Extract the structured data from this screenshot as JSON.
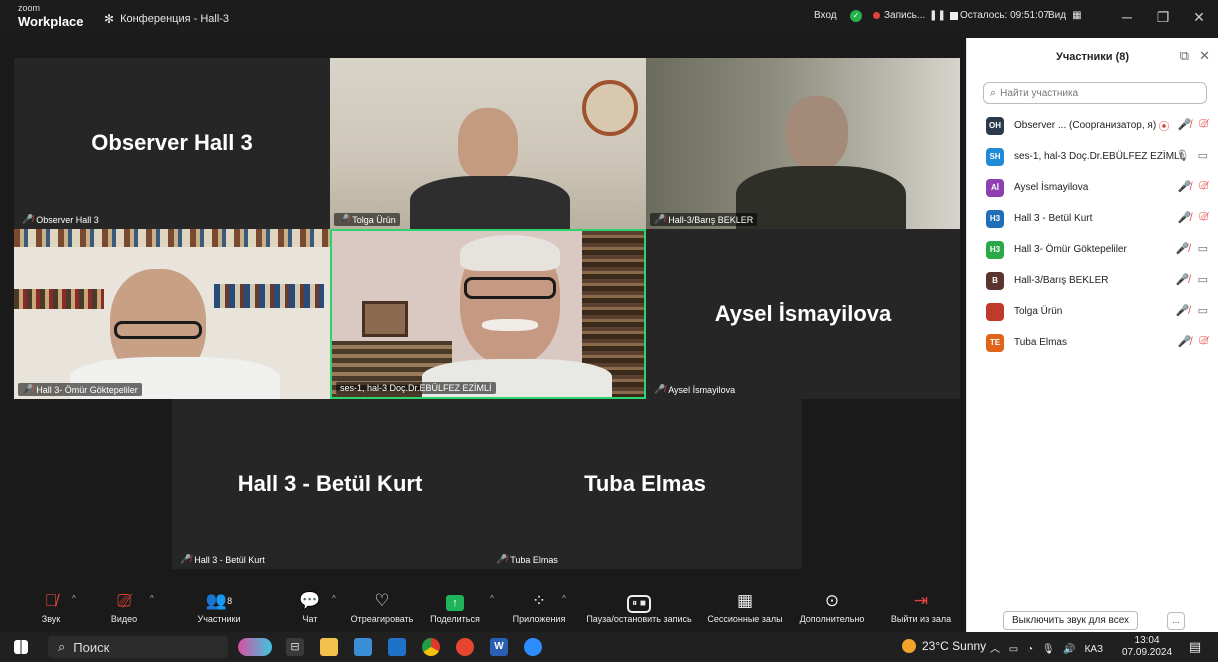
{
  "app": {
    "logo_top": "zoom",
    "logo_bottom": "Workplace",
    "meeting_title": "Конференция - Hall-3"
  },
  "topbar": {
    "login": "Вход",
    "recording": "Запись...",
    "remaining": "Осталось: 09:51:07",
    "view": "Вид"
  },
  "tiles": {
    "observer": {
      "big": "Observer Hall 3",
      "tag": "Observer Hall 3"
    },
    "tolga": {
      "tag": "Tolga Ürün"
    },
    "baris": {
      "tag": "Hall-3/Barış BEKLER"
    },
    "omur": {
      "tag": "Hall 3- Ömür Göktepeliler"
    },
    "ebulfez": {
      "tag": "ses-1, hal-3 Doç.Dr.EBÜLFEZ EZİMLİ"
    },
    "aysel": {
      "big": "Aysel İsmayilova",
      "tag": "Aysel İsmayilova"
    },
    "betul": {
      "big": "Hall 3 - Betül Kurt",
      "tag": "Hall 3 - Betül Kurt"
    },
    "tuba": {
      "big": "Tuba Elmas",
      "tag": "Tuba Elmas"
    }
  },
  "toolbar": {
    "audio": "Звук",
    "video": "Видео",
    "participants": "Участники",
    "participants_count": "8",
    "chat": "Чат",
    "react": "Отреагировать",
    "share": "Поделиться",
    "apps": "Приложения",
    "pause_rec": "Пауза/остановить запись",
    "breakout": "Сессионные залы",
    "more": "Дополнительно",
    "leave": "Выйти из зала"
  },
  "panel": {
    "title": "Участники (8)",
    "search_placeholder": "Найти участника",
    "participants": [
      {
        "initials": "OH",
        "name": "Observer ... (Соорганизатор, я)",
        "color": "#2a3a4a"
      },
      {
        "initials": "SH",
        "name": "ses-1, hal-3 Doç.Dr.EBÜLFEZ EZİMLİ",
        "color": "#1f8ad6"
      },
      {
        "initials": "Aİ",
        "name": "Aysel İsmayilova",
        "color": "#8e3fb0"
      },
      {
        "initials": "H3",
        "name": "Hall 3 - Betül Kurt",
        "color": "#1f6fb8"
      },
      {
        "initials": "H3",
        "name": "Hall 3- Ömür Göktepeliler",
        "color": "#2aa84a"
      },
      {
        "initials": "B",
        "name": "Hall-3/Barış BEKLER",
        "color": "#5a3530"
      },
      {
        "initials": "",
        "name": "Tolga Ürün",
        "color": "#c0392b"
      },
      {
        "initials": "TE",
        "name": "Tuba Elmas",
        "color": "#e0651a"
      }
    ],
    "mute_all": "Выключить звук для всех",
    "more": "..."
  },
  "taskbar": {
    "search": "Поиск",
    "weather": "23°C  Sunny",
    "lang": "КАЗ",
    "time": "13:04",
    "date": "07.09.2024"
  }
}
